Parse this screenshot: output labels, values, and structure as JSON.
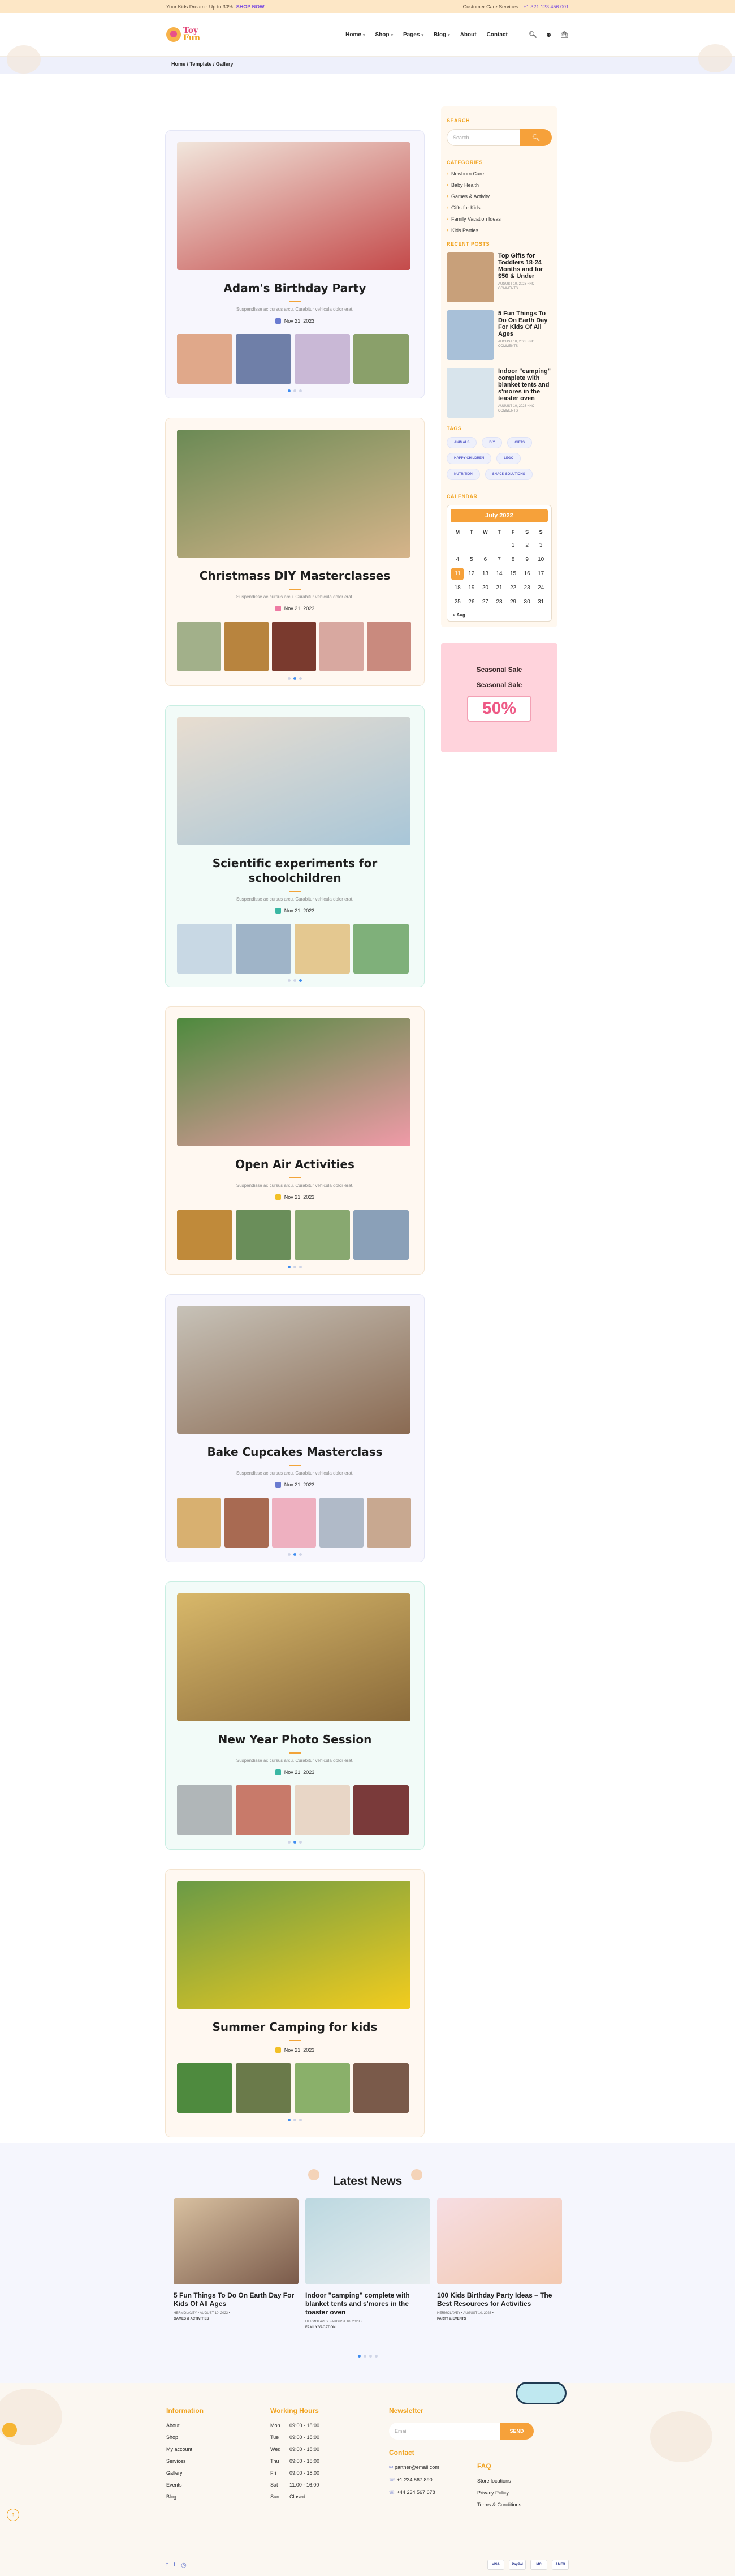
{
  "topbar": {
    "promo": "Your Kids Dream - Up to 30%",
    "promo_link": "SHOP NOW",
    "support": "Customer Care Services :",
    "phone": "+1 321 123 456 001"
  },
  "header": {
    "logo_line1": "Toy",
    "logo_line2": "Fun",
    "nav": [
      {
        "label": "Home",
        "chev": "▾"
      },
      {
        "label": "Shop",
        "chev": "▾"
      },
      {
        "label": "Pages",
        "chev": "▾"
      },
      {
        "label": "Blog",
        "chev": "▾"
      },
      {
        "label": "About",
        "chev": ""
      },
      {
        "label": "Contact",
        "chev": ""
      }
    ]
  },
  "breadcrumb": "Home / Template / Gallery",
  "posts": [
    {
      "title": "Adam's Birthday Party",
      "excerpt": "Suspendisse ac cursus arcu. Curabitur vehicula dolor erat.",
      "date": "Nov 21, 2023"
    },
    {
      "title": "Christmass DIY Masterclasses",
      "excerpt": "Suspendisse ac cursus arcu. Curabitur vehicula dolor erat.",
      "date": "Nov 21, 2023"
    },
    {
      "title": "Scientific experiments for schoolchildren",
      "excerpt": "Suspendisse ac cursus arcu. Curabitur vehicula dolor erat.",
      "date": "Nov 21, 2023"
    },
    {
      "title": "Open Air Activities",
      "excerpt": "Suspendisse ac cursus arcu. Curabitur vehicula dolor erat.",
      "date": "Nov 21, 2023"
    },
    {
      "title": "Bake Cupcakes Masterclass",
      "excerpt": "Suspendisse ac cursus arcu. Curabitur vehicula dolor erat.",
      "date": "Nov 21, 2023"
    },
    {
      "title": "New Year Photo Session",
      "excerpt": "Suspendisse ac cursus arcu. Curabitur vehicula dolor erat.",
      "date": "Nov 21, 2023"
    },
    {
      "title": "Summer Camping for kids",
      "excerpt": "",
      "date": "Nov 21, 2023"
    }
  ],
  "sidebar": {
    "search_title": "SEARCH",
    "search_placeholder": "Search...",
    "categories_title": "CATEGORIES",
    "categories": [
      "Newborn Care",
      "Baby Health",
      "Games & Activity",
      "Gifts for Kids",
      "Family Vacation Ideas",
      "Kids Parties"
    ],
    "recent_title": "RECENT POSTS",
    "recent": [
      {
        "title": "Top Gifts for Toddlers 18-24 Months and for $50 & Under",
        "meta": "AUGUST 10, 2023 • NO COMMENTS"
      },
      {
        "title": "5 Fun Things To Do On Earth Day For Kids Of All Ages",
        "meta": "AUGUST 10, 2023 • NO COMMENTS"
      },
      {
        "title": "Indoor \"camping\" complete with blanket tents and s'mores in the teaster oven",
        "meta": "AUGUST 10, 2023 • NO COMMENTS"
      }
    ],
    "tags_title": "TAGS",
    "tags": [
      "ANIMALS",
      "DIY",
      "GIFTS",
      "HAPPY CHILDREN",
      "LEGO",
      "NUTRITION",
      "SNACK SOLUTIONS"
    ],
    "calendar_title": "CALENDAR",
    "calendar_month": "July 2022",
    "calendar_days": [
      "M",
      "T",
      "W",
      "T",
      "F",
      "S",
      "S"
    ],
    "calendar_weeks": [
      [
        "",
        "",
        "",
        "",
        "1",
        "2",
        "3"
      ],
      [
        "4",
        "5",
        "6",
        "7",
        "8",
        "9",
        "10"
      ],
      [
        "11",
        "12",
        "13",
        "14",
        "15",
        "16",
        "17"
      ],
      [
        "18",
        "19",
        "20",
        "21",
        "22",
        "23",
        "24"
      ],
      [
        "25",
        "26",
        "27",
        "28",
        "29",
        "30",
        "31"
      ]
    ],
    "calendar_today": "11",
    "calendar_prev": "« Aug",
    "promo_a": "Seasonal Sale",
    "promo_b": "Seasonal Sale",
    "promo_pct": "50%"
  },
  "news": {
    "title": "Latest News",
    "items": [
      {
        "title": "5 Fun Things To Do On Earth Day For Kids Of All Ages",
        "meta": "HERMOLAVEY • AUGUST 10, 2023 •",
        "cat": "GAMES & ACTIVITIES"
      },
      {
        "title": "Indoor \"camping\" complete with blanket tents and s'mores in the toaster oven",
        "meta": "HERMOLAVEY • AUGUST 10, 2023 •",
        "cat": "FAMILY VACATION"
      },
      {
        "title": "100 Kids Birthday Party Ideas – The Best Resources for Activities",
        "meta": "HERMOLAVEY • AUGUST 10, 2023 •",
        "cat": "PARTY & EVENTS"
      }
    ]
  },
  "footer": {
    "info_title": "Information",
    "info_links": [
      "About",
      "Shop",
      "My account",
      "Services",
      "Gallery",
      "Events",
      "Blog"
    ],
    "hours_title": "Working Hours",
    "hours": [
      {
        "day": "Mon",
        "time": "09:00 - 18:00"
      },
      {
        "day": "Tue",
        "time": "09:00 - 18:00"
      },
      {
        "day": "Wed",
        "time": "09:00 - 18:00"
      },
      {
        "day": "Thu",
        "time": "09:00 - 18:00"
      },
      {
        "day": "Fri",
        "time": "09:00 - 18:00"
      },
      {
        "day": "Sat",
        "time": "11:00 - 16:00"
      },
      {
        "day": "Sun",
        "time": "Closed"
      }
    ],
    "newsletter_title": "Newsletter",
    "email_placeholder": "Email",
    "email_button": "SEND",
    "contact_title": "Contact",
    "contact": [
      "partner@email.com",
      "+1 234 567 890",
      "+44 234 567 678"
    ],
    "faq_title": "FAQ",
    "faq_links": [
      "Store locations",
      "Privacy Policy",
      "Terms & Conditions"
    ],
    "payments": [
      "VISA",
      "PayPal",
      "MC",
      "AMEX"
    ]
  }
}
